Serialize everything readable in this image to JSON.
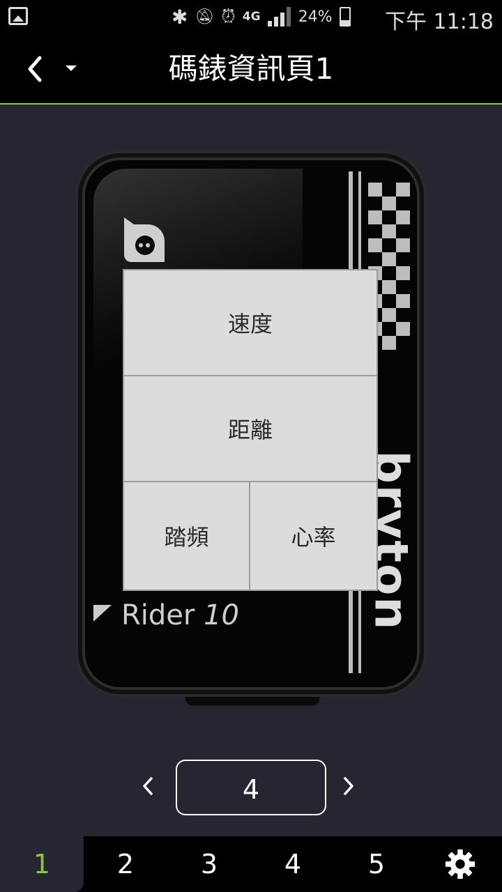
{
  "status_bar": {
    "network_label": "4G",
    "battery_percent": "24%",
    "time": "下午 11:18",
    "icons": [
      "gallery-icon",
      "bluetooth-icon",
      "vibrate-mute-icon",
      "alarm-icon",
      "signal-icon",
      "battery-icon"
    ]
  },
  "header": {
    "title": "碼錶資訊頁1",
    "back_icon": "chevron-left-icon",
    "menu_icon": "dropdown-caret-icon"
  },
  "device": {
    "model_name": "Rider",
    "model_number": "10",
    "brand": "bryton",
    "screen_fields": {
      "speed": "速度",
      "distance": "距離",
      "cadence": "踏頻",
      "heart_rate": "心率"
    }
  },
  "layout_selector": {
    "value": "4",
    "prev_icon": "chevron-left-icon",
    "next_icon": "chevron-right-icon"
  },
  "tabs": {
    "items": [
      {
        "label": "1",
        "active": true
      },
      {
        "label": "2",
        "active": false
      },
      {
        "label": "3",
        "active": false
      },
      {
        "label": "4",
        "active": false
      },
      {
        "label": "5",
        "active": false
      }
    ],
    "settings_icon": "gear-icon"
  },
  "colors": {
    "accent": "#8cc63f",
    "background": "#262633",
    "bar": "#000000"
  }
}
